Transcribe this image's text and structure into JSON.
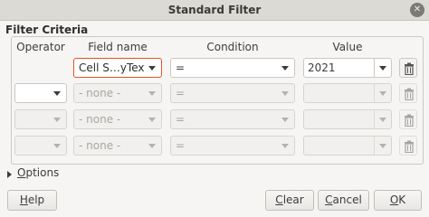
{
  "window": {
    "title": "Standard Filter"
  },
  "section": {
    "title": "Filter Criteria"
  },
  "columns": {
    "operator": "Operator",
    "field_name": "Field name",
    "condition": "Condition",
    "value": "Value"
  },
  "rows": [
    {
      "operator": "",
      "field": "Cell S…yText",
      "condition": "=",
      "value": "2021"
    },
    {
      "operator": "",
      "field": "- none -",
      "condition": "=",
      "value": ""
    },
    {
      "operator": "",
      "field": "- none -",
      "condition": "=",
      "value": ""
    },
    {
      "operator": "",
      "field": "- none -",
      "condition": "=",
      "value": ""
    }
  ],
  "options": {
    "label_prefix": "O",
    "label_rest": "ptions"
  },
  "buttons": {
    "help_mn": "H",
    "help_rest": "elp",
    "clear_mn": "C",
    "clear_rest": "lear",
    "cancel_mn": "C",
    "cancel_rest": "ancel",
    "ok_mn": "O",
    "ok_rest": "K"
  },
  "colors": {
    "accent": "#e95420",
    "window_bg": "#f6f5f4",
    "titlebar_bg": "#dcdad5"
  },
  "icons": {
    "close": "close-icon",
    "delete": "trash-icon",
    "expander": "triangle-right-icon"
  }
}
